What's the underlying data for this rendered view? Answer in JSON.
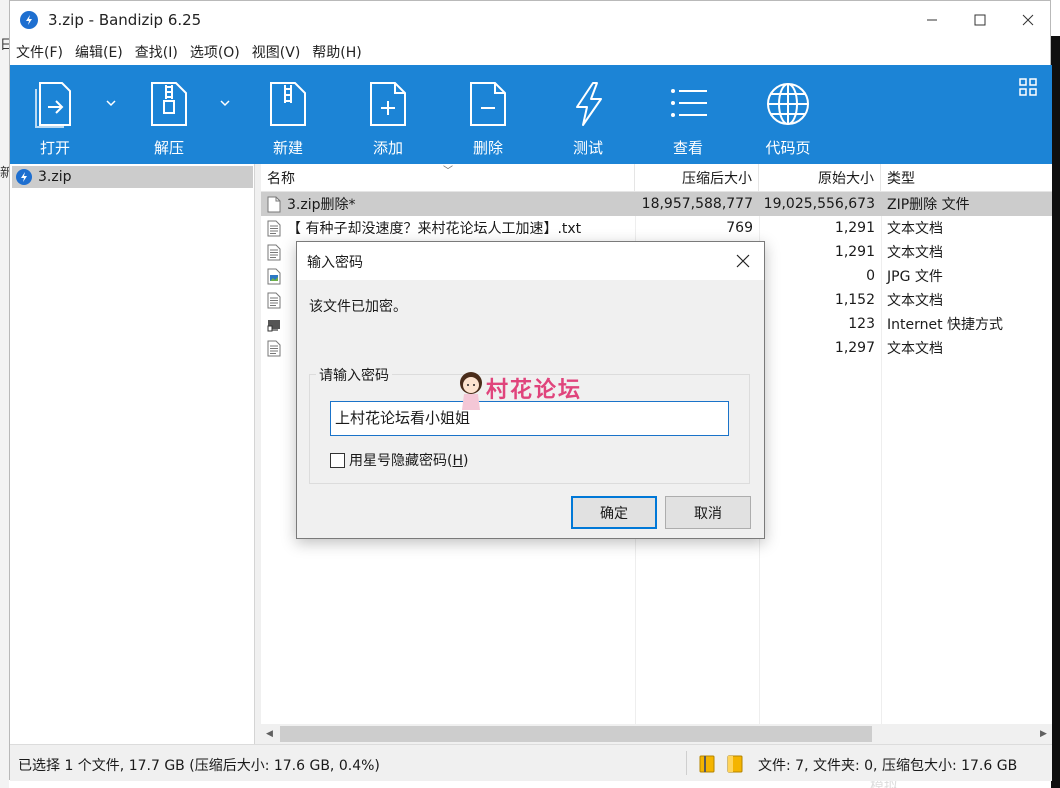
{
  "window": {
    "title": "3.zip - Bandizip 6.25",
    "controls": {
      "minimize": "—",
      "maximize": "☐",
      "close": "✕"
    }
  },
  "menu": [
    "文件(F)",
    "编辑(E)",
    "查找(I)",
    "选项(O)",
    "视图(V)",
    "帮助(H)"
  ],
  "toolbar": {
    "buttons": [
      {
        "label": "打开",
        "icon": "open-icon"
      },
      {
        "label": "解压",
        "icon": "extract-icon"
      },
      {
        "label": "新建",
        "icon": "new-archive-icon"
      },
      {
        "label": "添加",
        "icon": "add-file-icon"
      },
      {
        "label": "删除",
        "icon": "delete-file-icon"
      },
      {
        "label": "测试",
        "icon": "test-icon"
      },
      {
        "label": "查看",
        "icon": "view-list-icon"
      },
      {
        "label": "代码页",
        "icon": "codepage-globe-icon"
      }
    ],
    "accent": "#1c84d6"
  },
  "tree": {
    "item": "3.zip"
  },
  "columns": {
    "name": "名称",
    "compressed": "压缩后大小",
    "original": "原始大小",
    "type": "类型"
  },
  "rows": [
    {
      "name": "3.zip删除*",
      "compressed": "18,957,588,777",
      "original": "19,025,556,673",
      "type": "ZIP删除 文件",
      "icon": "file-icon",
      "selected": true
    },
    {
      "name": "【 有种子却没速度？来村花论坛人工加速】.txt",
      "compressed": "769",
      "original": "1,291",
      "type": "文本文档",
      "icon": "text-file-icon",
      "selected": false
    },
    {
      "name": "【",
      "compressed": "",
      "original": "1,291",
      "type": "文本文档",
      "icon": "text-file-icon",
      "selected": false
    },
    {
      "name": "【",
      "compressed": "",
      "original": "0",
      "type": "JPG 文件",
      "icon": "image-file-icon",
      "selected": false
    },
    {
      "name": "【",
      "compressed": "",
      "original": "1,152",
      "type": "文本文档",
      "icon": "text-file-icon",
      "selected": false
    },
    {
      "name": "【",
      "compressed": "",
      "original": "123",
      "type": "Internet 快捷方式",
      "icon": "internet-shortcut-icon",
      "selected": false
    },
    {
      "name": "【",
      "compressed": "",
      "original": "1,297",
      "type": "文本文档",
      "icon": "text-file-icon",
      "selected": false
    }
  ],
  "status": {
    "left": "已选择 1 个文件, 17.7 GB (压缩后大小: 17.6 GB, 0.4%)",
    "right": "文件: 7, 文件夹: 0, 压缩包大小: 17.6 GB"
  },
  "dialog": {
    "title": "输入密码",
    "message": "该文件已加密。",
    "group_label": "请输入密码",
    "password_value": "上村花论坛看小姐姐",
    "checkbox_label": "用星号隐藏密码(",
    "checkbox_hotkey": "H",
    "checkbox_suffix": ")",
    "checkbox_checked": false,
    "ok": "确定",
    "cancel": "取消"
  },
  "watermark": {
    "text": "村花论坛"
  },
  "desktop": {
    "left_chars": [
      "日",
      "新"
    ],
    "bottom_right": "模拟"
  }
}
